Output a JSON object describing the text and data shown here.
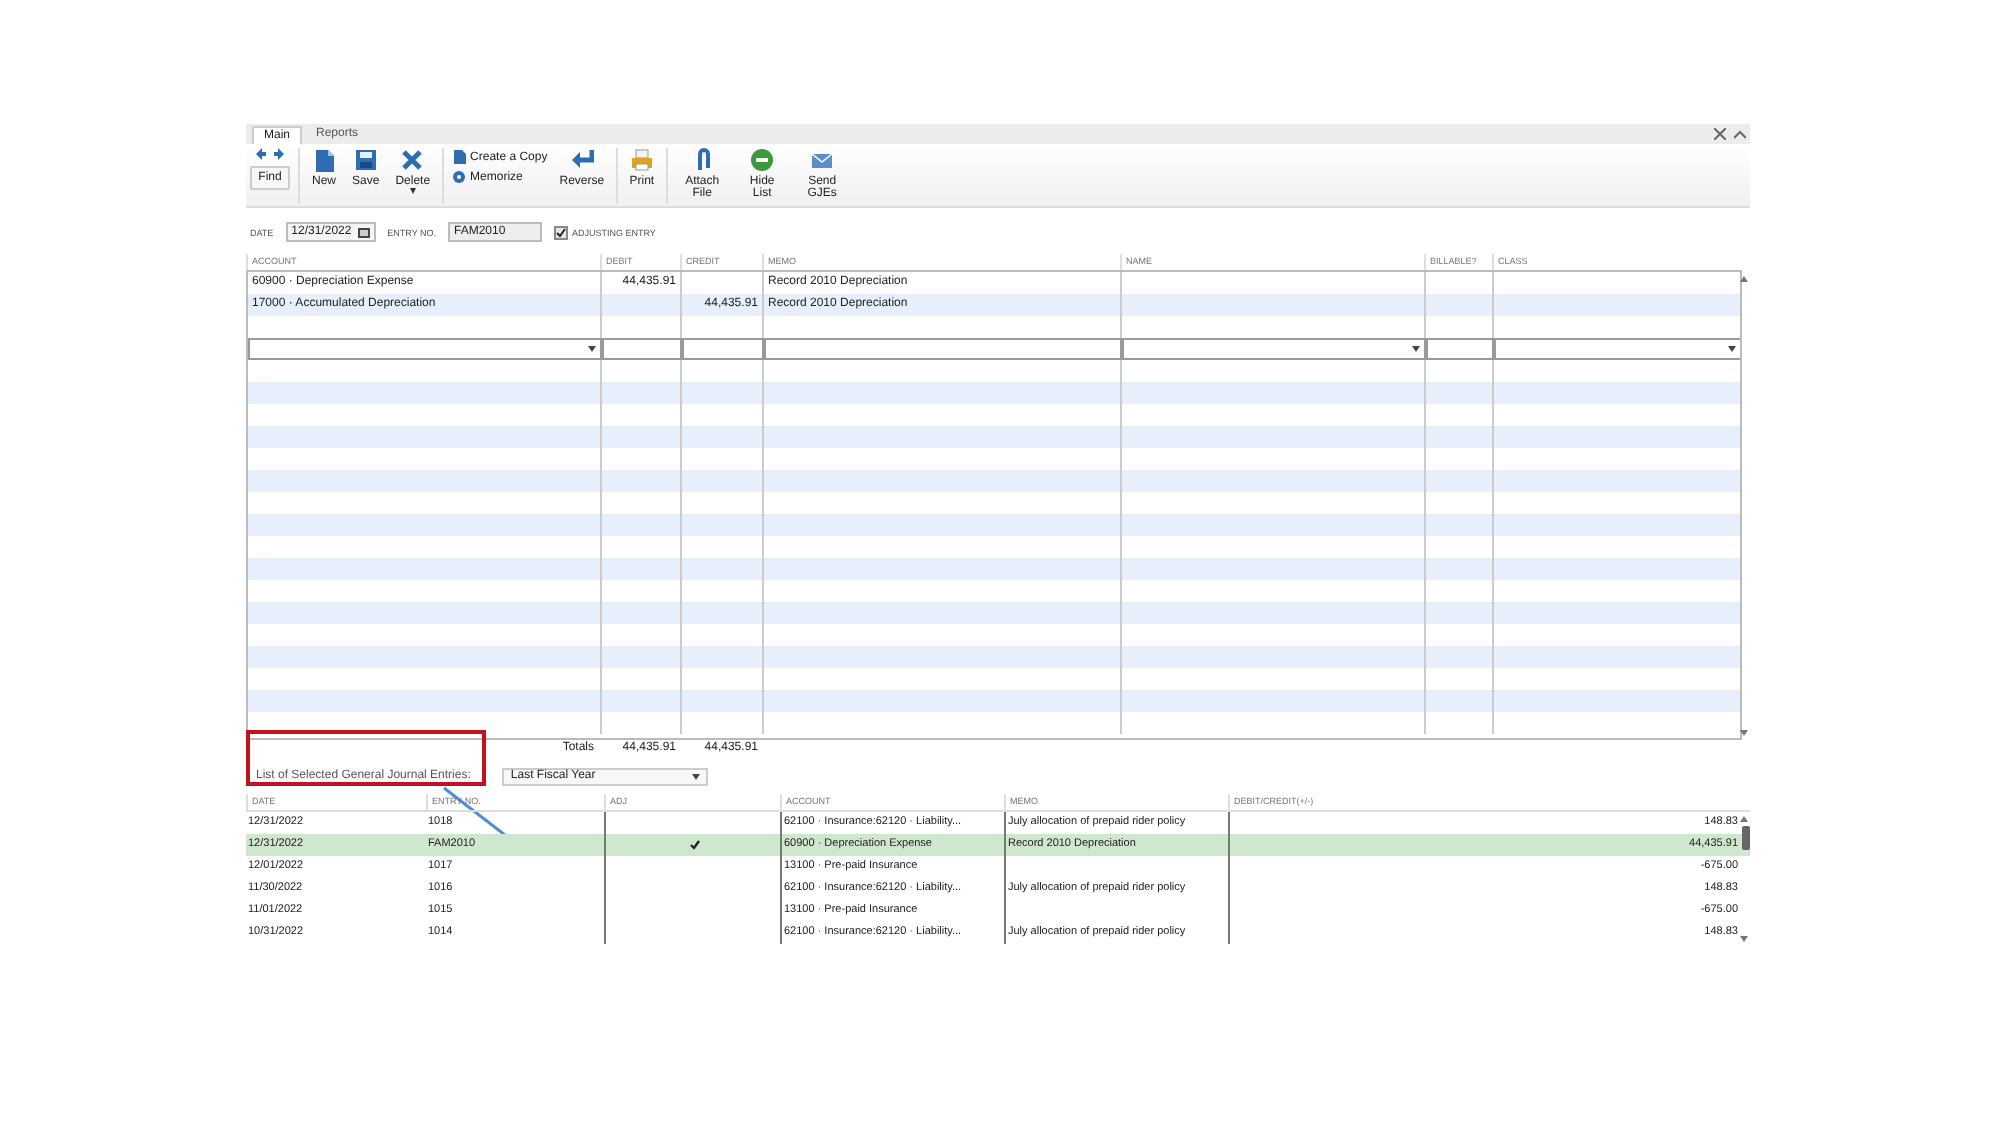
{
  "tabs": [
    {
      "label": "Main",
      "selected": true
    },
    {
      "label": "Reports",
      "selected": false
    }
  ],
  "toolbar": [
    {
      "kind": "find",
      "label": "Find"
    },
    {
      "kind": "new",
      "label": "New"
    },
    {
      "kind": "save",
      "label": "Save"
    },
    {
      "kind": "delete",
      "label": "Delete"
    },
    {
      "kind": "pair",
      "items": [
        "Create a Copy",
        "Memorize"
      ]
    },
    {
      "kind": "reverse",
      "label": "Reverse"
    },
    {
      "kind": "print",
      "label": "Print"
    },
    {
      "kind": "attach",
      "label": "Attach File"
    },
    {
      "kind": "hide",
      "label": "Hide List"
    },
    {
      "kind": "send",
      "label": "Send GJEs"
    }
  ],
  "form": {
    "date_label": "DATE",
    "date": "12/31/2022",
    "entry_label": "ENTRY NO.",
    "entry_no": "FAM2010",
    "adjusting_label": "ADJUSTING ENTRY",
    "adjusting": true
  },
  "entry_table": {
    "columns": [
      "ACCOUNT",
      "DEBIT",
      "CREDIT",
      "MEMO",
      "NAME",
      "BILLABLE?",
      "CLASS"
    ],
    "rows": [
      [
        "60900 · Depreciation Expense",
        "44,435.91",
        "",
        "Record 2010 Depreciation",
        "",
        "",
        ""
      ],
      [
        "17000 · Accumulated Depreciation",
        "",
        "44,435.91",
        "Record 2010 Depreciation",
        "",
        "",
        ""
      ]
    ],
    "totals_label": "Totals",
    "total_debit": "44,435.91",
    "total_credit": "44,435.91"
  },
  "filter": {
    "label": "List of Selected General Journal Entries:",
    "value": "Last Fiscal Year"
  },
  "journal_list": {
    "columns": [
      "DATE",
      "ENTRY NO.",
      "ADJ",
      "ACCOUNT",
      "MEMO",
      "DEBIT/CREDIT(+/-)"
    ],
    "rows": [
      {
        "cells": [
          "12/31/2022",
          "1018",
          "",
          "62100 · Insurance:62120 · Liability...",
          "July allocation of prepaid rider policy",
          "148.83"
        ],
        "adj": false,
        "selected": false
      },
      {
        "cells": [
          "12/31/2022",
          "FAM2010",
          "",
          "60900 · Depreciation Expense",
          "Record 2010 Depreciation",
          "44,435.91"
        ],
        "adj": true,
        "selected": true
      },
      {
        "cells": [
          "12/01/2022",
          "1017",
          "",
          "13100 · Pre-paid Insurance",
          "",
          "-675.00"
        ],
        "adj": false,
        "selected": false
      },
      {
        "cells": [
          "11/30/2022",
          "1016",
          "",
          "62100 · Insurance:62120 · Liability...",
          "July allocation of prepaid rider policy",
          "148.83"
        ],
        "adj": false,
        "selected": false
      },
      {
        "cells": [
          "11/01/2022",
          "1015",
          "",
          "13100 · Pre-paid Insurance",
          "",
          "-675.00"
        ],
        "adj": false,
        "selected": false
      },
      {
        "cells": [
          "10/31/2022",
          "1014",
          "",
          "62100 · Insurance:62120 · Liability...",
          "July allocation of prepaid rider policy",
          "148.83"
        ],
        "adj": false,
        "selected": false
      }
    ]
  }
}
